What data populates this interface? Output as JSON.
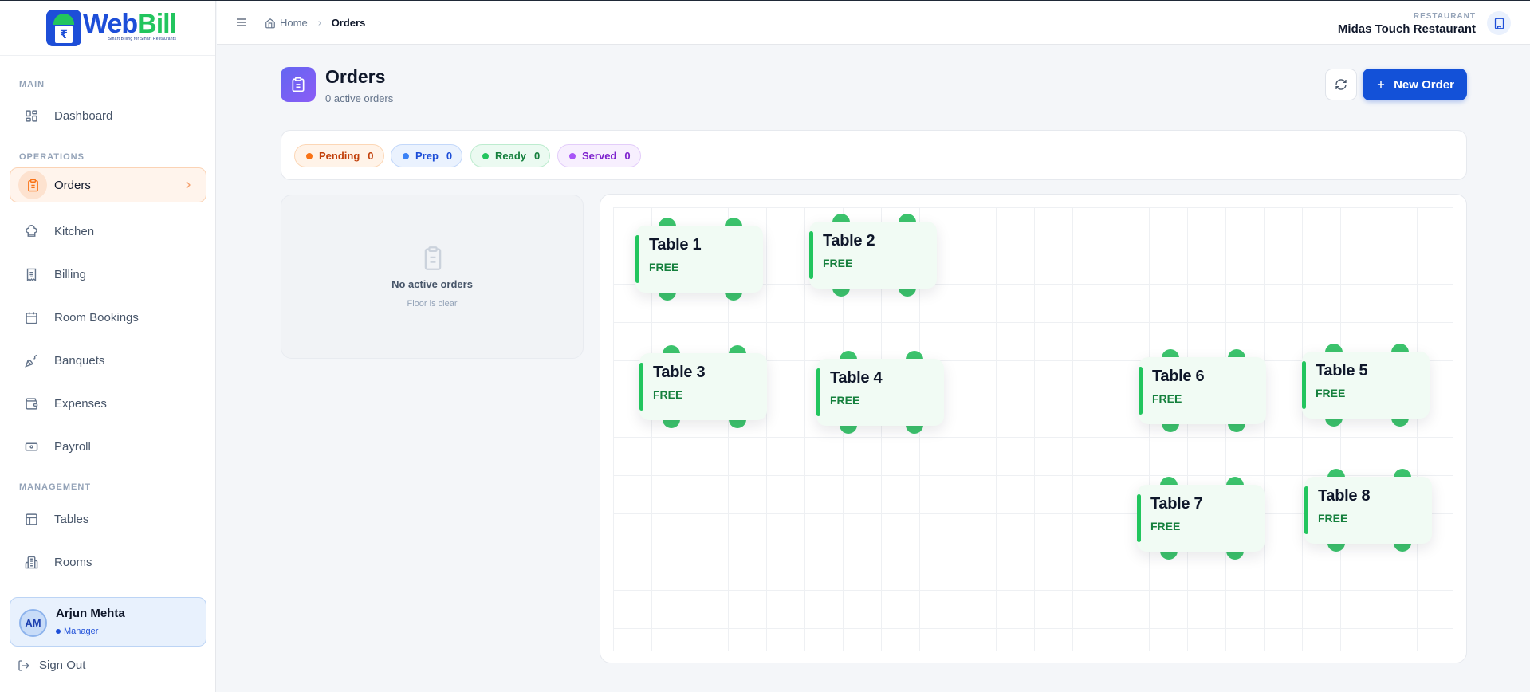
{
  "app": {
    "logo_name_a": "Web",
    "logo_name_b": "Bill",
    "logo_symbol": "₹",
    "logo_tagline": "Smart Billing for Smart Restaurants"
  },
  "sidebar": {
    "sections": {
      "main": "MAIN",
      "operations": "OPERATIONS",
      "management": "MANAGEMENT"
    },
    "items": [
      {
        "label": "Dashboard",
        "icon": "grid-icon"
      },
      {
        "label": "Orders",
        "icon": "clipboard-icon",
        "active": true
      },
      {
        "label": "Kitchen",
        "icon": "chef-hat-icon"
      },
      {
        "label": "Billing",
        "icon": "receipt-icon"
      },
      {
        "label": "Room Bookings",
        "icon": "calendar-icon"
      },
      {
        "label": "Banquets",
        "icon": "party-icon"
      },
      {
        "label": "Expenses",
        "icon": "wallet-icon"
      },
      {
        "label": "Payroll",
        "icon": "banknote-icon"
      },
      {
        "label": "Tables",
        "icon": "table-icon"
      },
      {
        "label": "Rooms",
        "icon": "building-icon"
      }
    ],
    "user": {
      "initials": "AM",
      "name": "Arjun Mehta",
      "role": "Manager"
    },
    "sign_out": "Sign Out"
  },
  "header": {
    "breadcrumb_home": "Home",
    "breadcrumb_current": "Orders",
    "restaurant_label": "RESTAURANT",
    "restaurant_name": "Midas Touch Restaurant"
  },
  "page": {
    "title": "Orders",
    "subtitle": "0 active orders",
    "new_order_label": "New Order"
  },
  "status_chips": [
    {
      "label": "Pending",
      "count": "0",
      "color": "#f97316"
    },
    {
      "label": "Prep",
      "count": "0",
      "color": "#3b82f6"
    },
    {
      "label": "Ready",
      "count": "0",
      "color": "#22c55e"
    },
    {
      "label": "Served",
      "count": "0",
      "color": "#a855f7"
    }
  ],
  "orders_list": {
    "empty_title": "No active orders",
    "empty_subtitle": "Floor is clear"
  },
  "floor_tables": [
    {
      "name": "Table 1",
      "status": "FREE"
    },
    {
      "name": "Table 2",
      "status": "FREE"
    },
    {
      "name": "Table 3",
      "status": "FREE"
    },
    {
      "name": "Table 4",
      "status": "FREE"
    },
    {
      "name": "Table 5",
      "status": "FREE"
    },
    {
      "name": "Table 6",
      "status": "FREE"
    },
    {
      "name": "Table 7",
      "status": "FREE"
    },
    {
      "name": "Table 8",
      "status": "FREE"
    }
  ],
  "colors": {
    "accent": "#1351d8",
    "free": "#22c55e",
    "active_nav": "#fff4ec"
  }
}
